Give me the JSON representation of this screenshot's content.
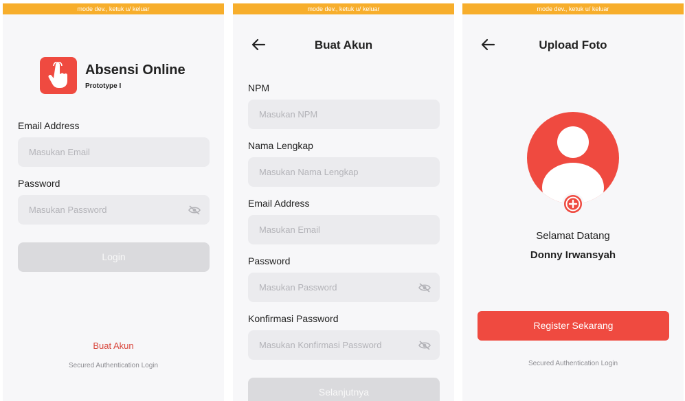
{
  "devbar": "mode dev., ketuk u/ keluar",
  "login": {
    "app_title": "Absensi Online",
    "app_subtitle": "Prototype I",
    "email_label": "Email Address",
    "email_placeholder": "Masukan Email",
    "password_label": "Password",
    "password_placeholder": "Masukan Password",
    "login_button": "Login",
    "create_account_link": "Buat Akun",
    "footer": "Secured Authentication Login"
  },
  "register": {
    "title": "Buat Akun",
    "npm_label": "NPM",
    "npm_placeholder": "Masukan NPM",
    "name_label": "Nama Lengkap",
    "name_placeholder": "Masukan Nama Lengkap",
    "email_label": "Email Address",
    "email_placeholder": "Masukan Email",
    "password_label": "Password",
    "password_placeholder": "Masukan Password",
    "confirm_label": "Konfirmasi Password",
    "confirm_placeholder": "Masukan Konfirmasi Password",
    "next_button": "Selanjutnya"
  },
  "upload": {
    "title": "Upload Foto",
    "welcome": "Selamat Datang",
    "user_name": "Donny Irwansyah",
    "register_button": "Register Sekarang",
    "footer": "Secured Authentication Login"
  },
  "colors": {
    "accent": "#ef4a40",
    "devbar": "#f7ae2c",
    "input_bg": "#ebebee"
  }
}
